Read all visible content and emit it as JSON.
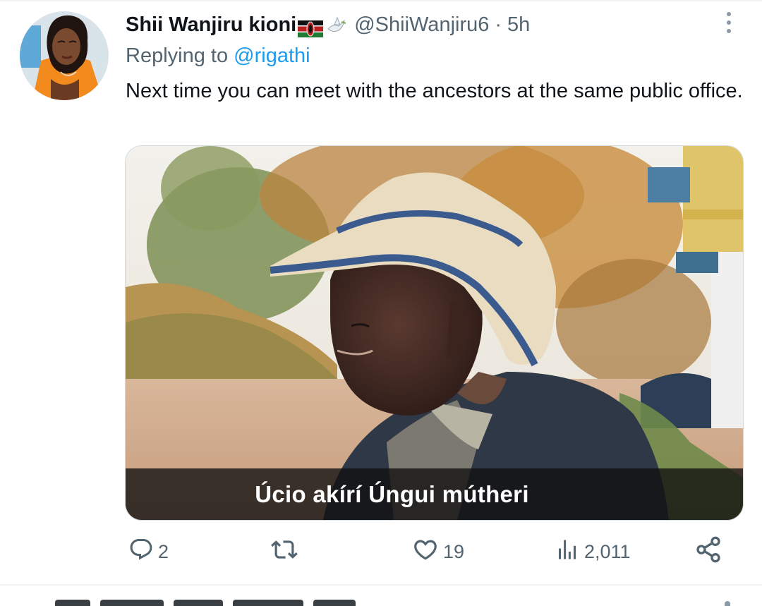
{
  "tweet": {
    "display_name": "Shii Wanjiru kioni",
    "handle": "@ShiiWanjiru6",
    "separator": "·",
    "time": "5h",
    "reply_prefix": "Replying to",
    "reply_to": "@rigathi",
    "text": "Next time you can meet with the ancestors at the same public office.",
    "media": {
      "caption": "Úcio akírí Úngui mútheri"
    }
  },
  "actions": {
    "replies": "2",
    "retweets": "",
    "likes": "19",
    "views": "2,011"
  },
  "colors": {
    "text_primary": "#0f1419",
    "text_secondary": "#536471",
    "accent": "#1d9bf0"
  },
  "icons": {
    "more": "more-vertical-icon",
    "reply": "reply-icon",
    "retweet": "retweet-icon",
    "like": "heart-icon",
    "views": "analytics-icon",
    "share": "share-icon",
    "flag": "kenya-flag-emoji",
    "dove": "dove-emoji"
  }
}
